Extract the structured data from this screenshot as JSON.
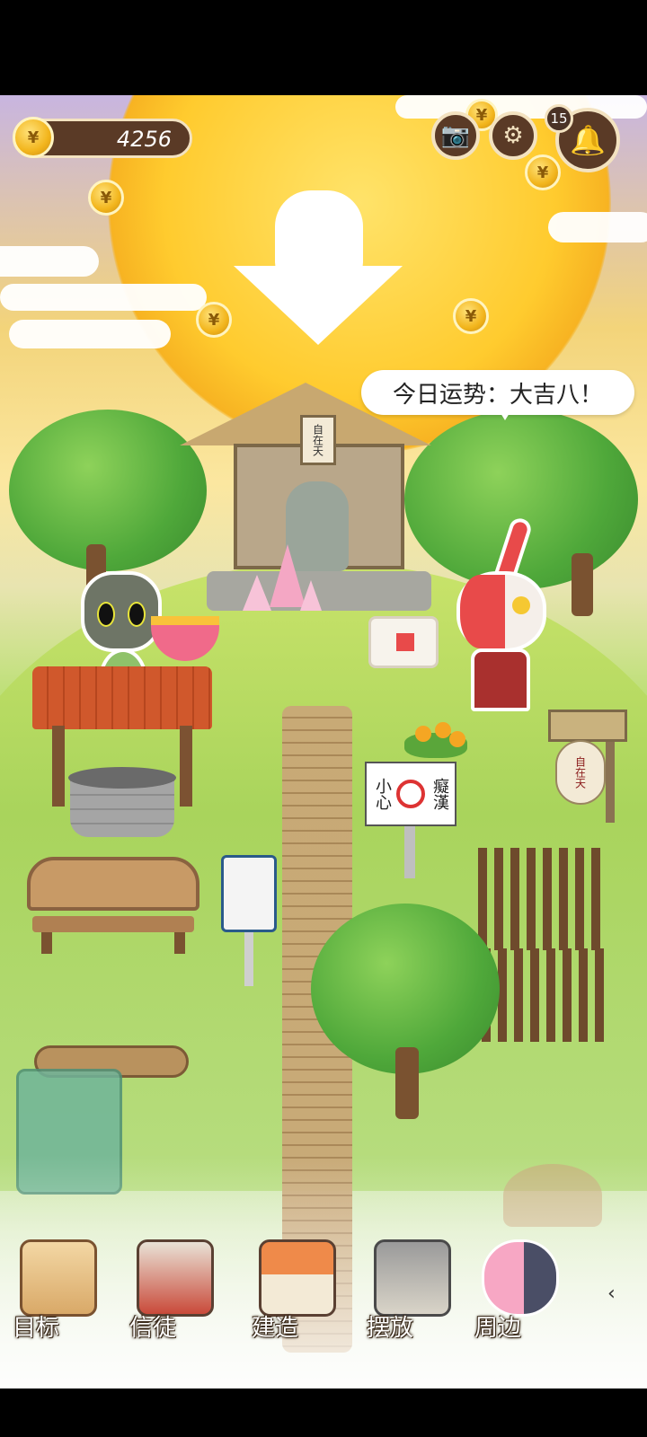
{
  "hud": {
    "coin_count": "4256",
    "notification_count": "15"
  },
  "speech_bubble": {
    "text": "今日运势：大吉八！"
  },
  "shrine": {
    "plaque_text": "自在天"
  },
  "sign_board": {
    "line1": "小心",
    "line2": "癡漢"
  },
  "lantern": {
    "text": "自在天"
  },
  "bottom_bar": {
    "items": [
      {
        "label": "目标",
        "icon": "drawer-chest-icon"
      },
      {
        "label": "信徒",
        "icon": "books-icon"
      },
      {
        "label": "建造",
        "icon": "house-icon"
      },
      {
        "label": "摆放",
        "icon": "shrine-gate-icon"
      },
      {
        "label": "周边",
        "icon": "characters-icon"
      }
    ],
    "more_arrow": "‹"
  },
  "colors": {
    "hud_brown": "#5a3a26",
    "hud_border": "#f3e2c0",
    "coin_gold": "#f2b51c",
    "grass": "#a9d45c",
    "sun": "#ffcb2e"
  }
}
